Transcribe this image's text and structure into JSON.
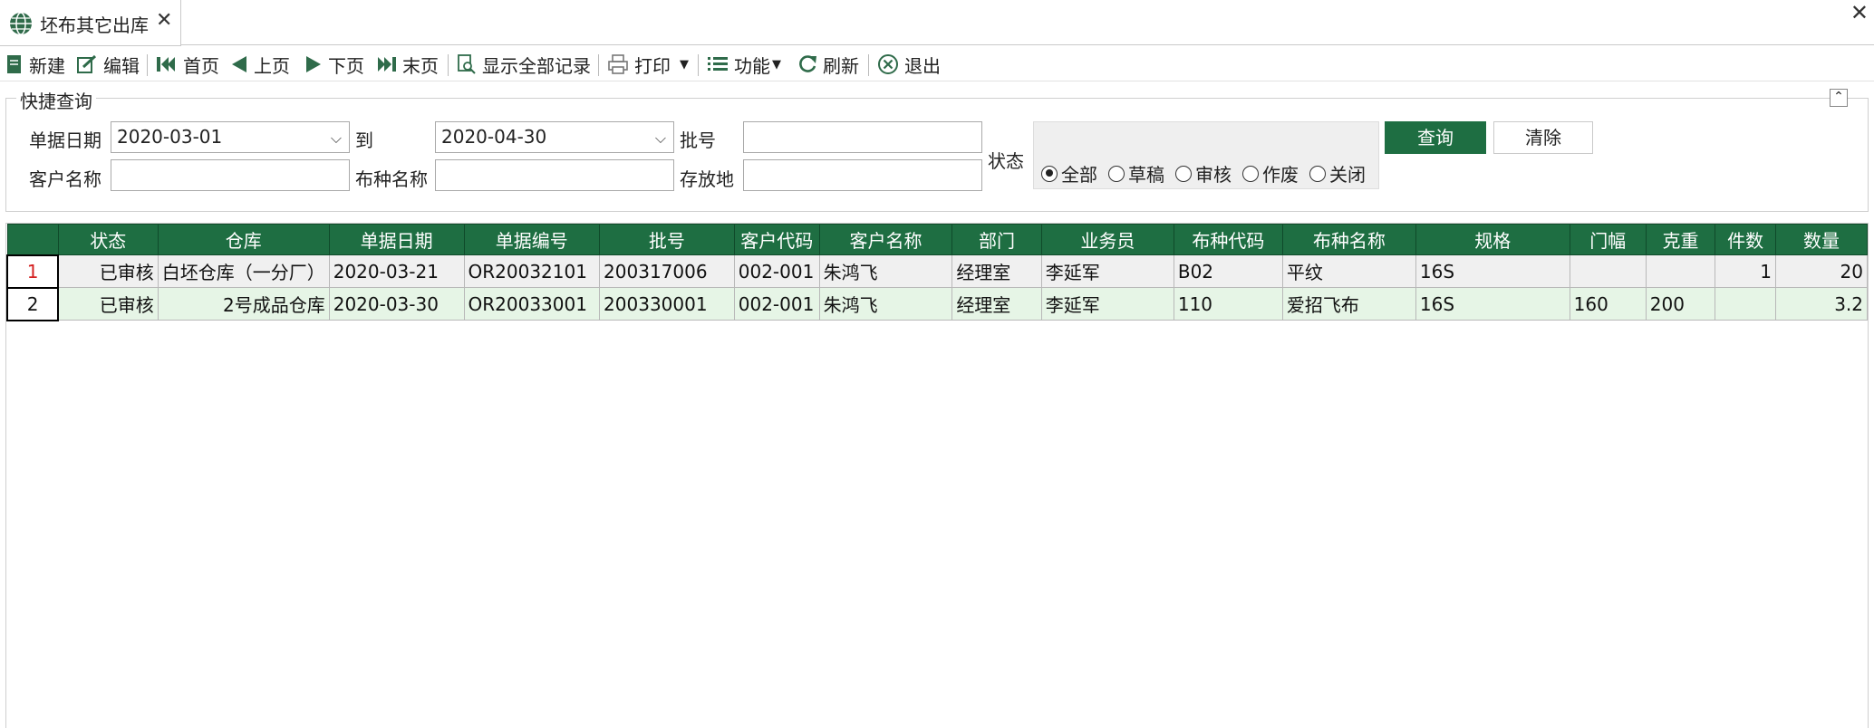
{
  "tab": {
    "title": "坯布其它出库",
    "close": "✕"
  },
  "window": {
    "close": "✕"
  },
  "toolbar": {
    "new": "新建",
    "edit": "编辑",
    "first": "首页",
    "prev": "上页",
    "next": "下页",
    "last": "末页",
    "show_all": "显示全部记录",
    "print": "打印",
    "function": "功能",
    "refresh": "刷新",
    "exit": "退出"
  },
  "query": {
    "legend": "快捷查询",
    "date_label": "单据日期",
    "date_from": "2020-03-01",
    "to_label": "到",
    "date_to": "2020-04-30",
    "batch_label": "批号",
    "batch_value": "",
    "customer_label": "客户名称",
    "customer_value": "",
    "fabric_label": "布种名称",
    "fabric_value": "",
    "location_label": "存放地",
    "location_value": "",
    "status_label": "状态",
    "status_options": [
      "全部",
      "草稿",
      "审核",
      "作废",
      "关闭"
    ],
    "status_selected": "全部",
    "query_button": "查询",
    "clear_button": "清除"
  },
  "grid": {
    "columns": [
      "状态",
      "仓库",
      "单据日期",
      "单据编号",
      "批号",
      "客户代码",
      "客户名称",
      "部门",
      "业务员",
      "布种代码",
      "布种名称",
      "规格",
      "门幅",
      "克重",
      "件数",
      "数量"
    ],
    "rows": [
      {
        "no": "1",
        "cells": [
          "已审核",
          "白坯仓库（一分厂）",
          "2020-03-21",
          "OR20032101",
          "200317006",
          "002-001",
          "朱鸿飞",
          "经理室",
          "李延军",
          "B02",
          "平纹",
          "16S",
          "",
          "",
          "1",
          "20"
        ]
      },
      {
        "no": "2",
        "cells": [
          "已审核",
          "2号成品仓库",
          "2020-03-30",
          "OR20033001",
          "200330001",
          "002-001",
          "朱鸿飞",
          "经理室",
          "李延军",
          "110",
          "爱招飞布",
          "16S",
          "160",
          "200",
          "",
          "3.2"
        ]
      }
    ]
  },
  "colors": {
    "accent": "#1e6e42",
    "selected_row": "#e6f5e6"
  }
}
